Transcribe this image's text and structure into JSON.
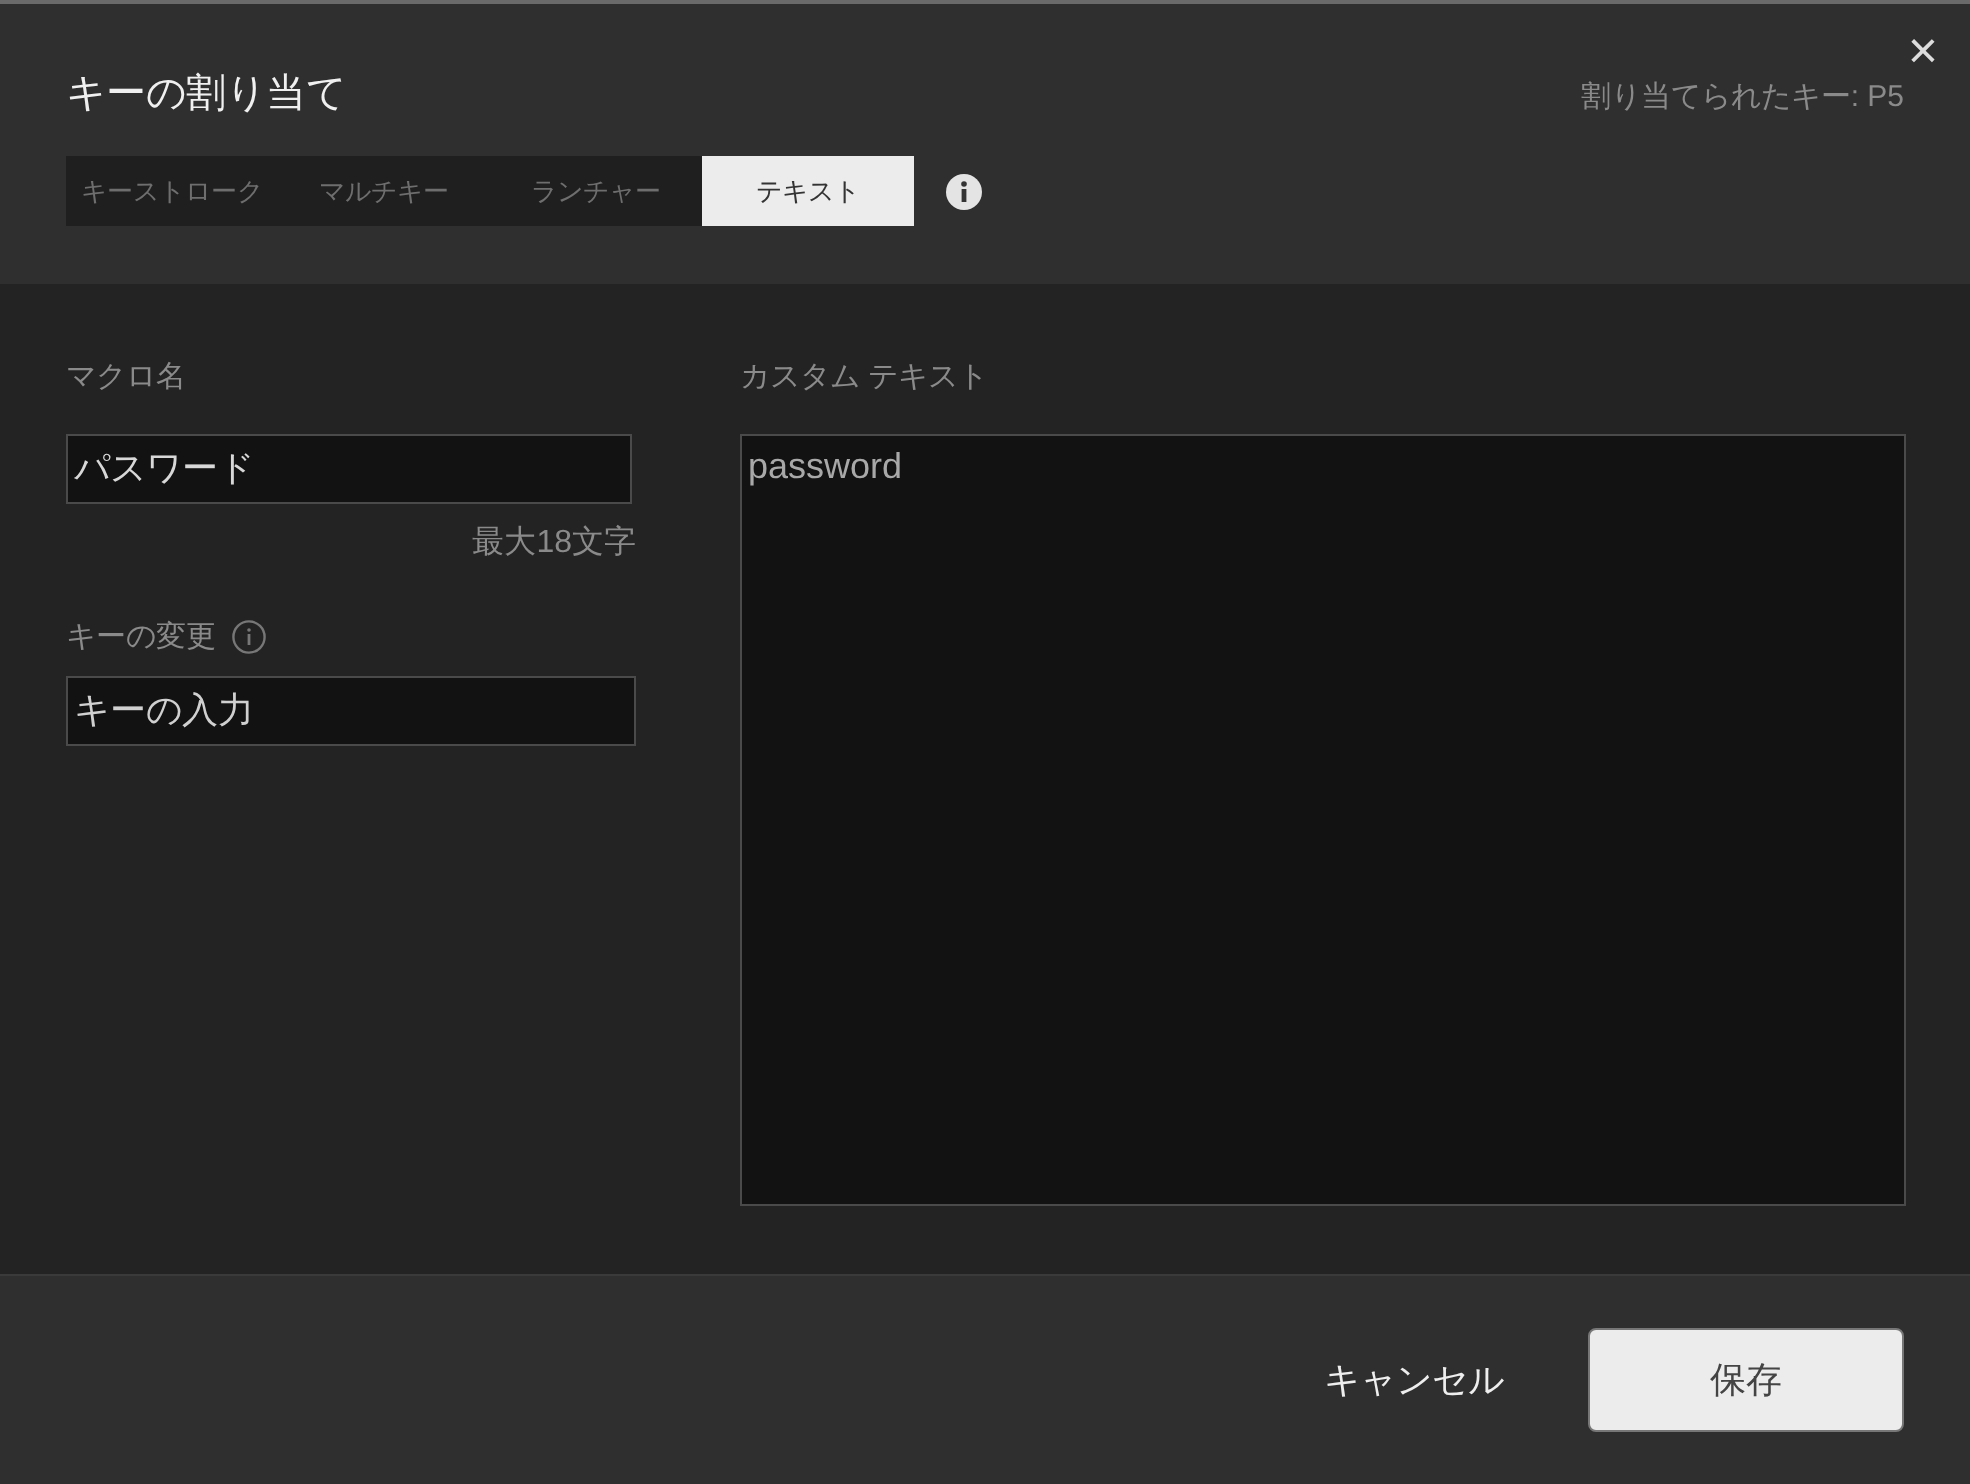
{
  "dialog": {
    "title": "キーの割り当て",
    "assigned_key": "割り当てられたキー: P5",
    "close": "×"
  },
  "tabs": [
    {
      "label": "キーストローク",
      "selected": false
    },
    {
      "label": "マルチキー",
      "selected": false
    },
    {
      "label": "ランチャー",
      "selected": false
    },
    {
      "label": "テキスト",
      "selected": true
    }
  ],
  "macro_name": {
    "label": "マクロ名",
    "value": "パスワード",
    "hint": "最大18文字"
  },
  "key_change": {
    "label": "キーの変更",
    "placeholder": "キーの入力"
  },
  "custom_text": {
    "label": "カスタム テキスト",
    "value": "password"
  },
  "buttons": {
    "cancel": "キャンセル",
    "save": "保存"
  }
}
